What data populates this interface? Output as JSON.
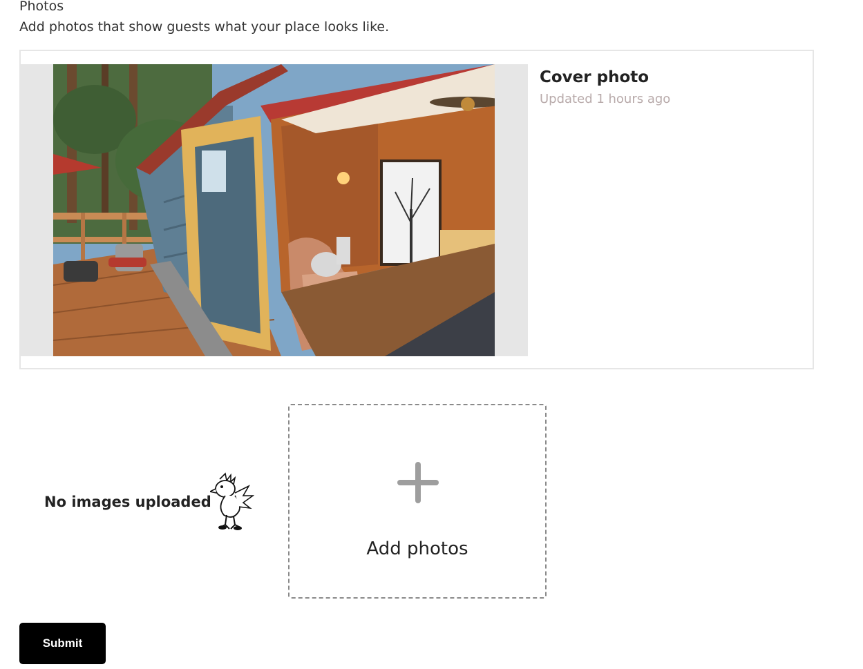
{
  "section": {
    "title": "Photos",
    "subtitle": "Add photos that show guests what your place looks like."
  },
  "cover": {
    "heading": "Cover photo",
    "updated": "Updated 1 hours ago",
    "image_icon": "cabin-porch-photo"
  },
  "empty_state": {
    "label": "No images uploaded",
    "mascot_icon": "chocobo-mascot-icon"
  },
  "uploader": {
    "label": "Add photos",
    "icon": "plus-icon"
  },
  "actions": {
    "submit_label": "Submit"
  },
  "colors": {
    "primary_button": "#000000",
    "muted_text": "#b8aaaa",
    "dashed_border": "#8a8a8a",
    "plus_icon": "#9e9e9e"
  }
}
